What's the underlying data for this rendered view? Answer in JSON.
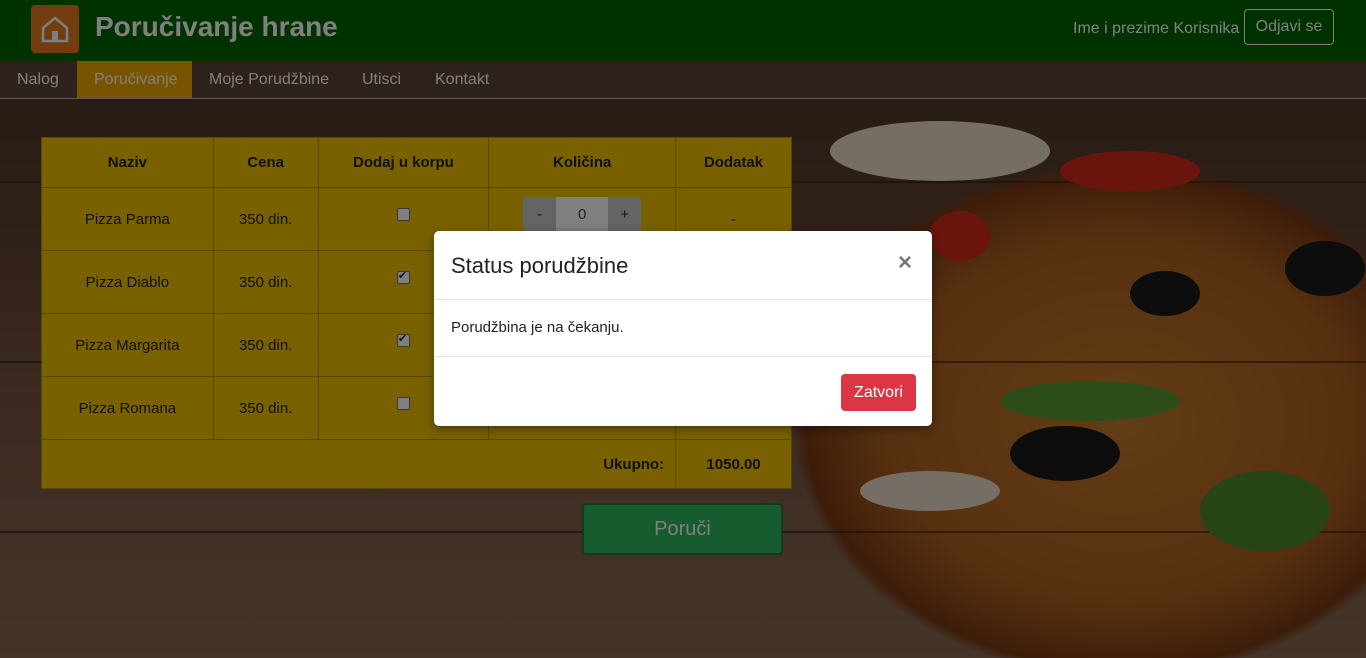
{
  "header": {
    "brand": "Poručivanje hrane",
    "user_name": "Ime i prezime Korisnika",
    "logout_label": "Odjavi se"
  },
  "nav": {
    "tabs": [
      {
        "label": "Nalog",
        "active": false
      },
      {
        "label": "Poručivanje",
        "active": true
      },
      {
        "label": "Moje Porudžbine",
        "active": false
      },
      {
        "label": "Utisci",
        "active": false
      },
      {
        "label": "Kontakt",
        "active": false
      }
    ]
  },
  "table": {
    "headers": [
      "Naziv",
      "Cena",
      "Dodaj u korpu",
      "Količina",
      "Dodatak"
    ],
    "rows": [
      {
        "name": "Pizza Parma",
        "price": "350 din.",
        "in_cart": false,
        "qty_minus": "-",
        "qty": "0",
        "qty_plus": "+",
        "extra": "-"
      },
      {
        "name": "Pizza Diablo",
        "price": "350 din.",
        "in_cart": true
      },
      {
        "name": "Pizza Margarita",
        "price": "350 din.",
        "in_cart": true
      },
      {
        "name": "Pizza Romana",
        "price": "350 din.",
        "in_cart": false
      }
    ],
    "total_label": "Ukupno:",
    "total_value": "1050.00"
  },
  "order_button": "Poruči",
  "modal": {
    "title": "Status porudžbine",
    "close_symbol": "×",
    "message": "Porudžbina je na čekanju.",
    "close_label": "Zatvori"
  },
  "colors": {
    "navbar": "#006400",
    "active_tab": "#f2a900",
    "table_bg": "#f2c200",
    "order_button": "#2eb85c",
    "close_button": "#dc3545"
  }
}
